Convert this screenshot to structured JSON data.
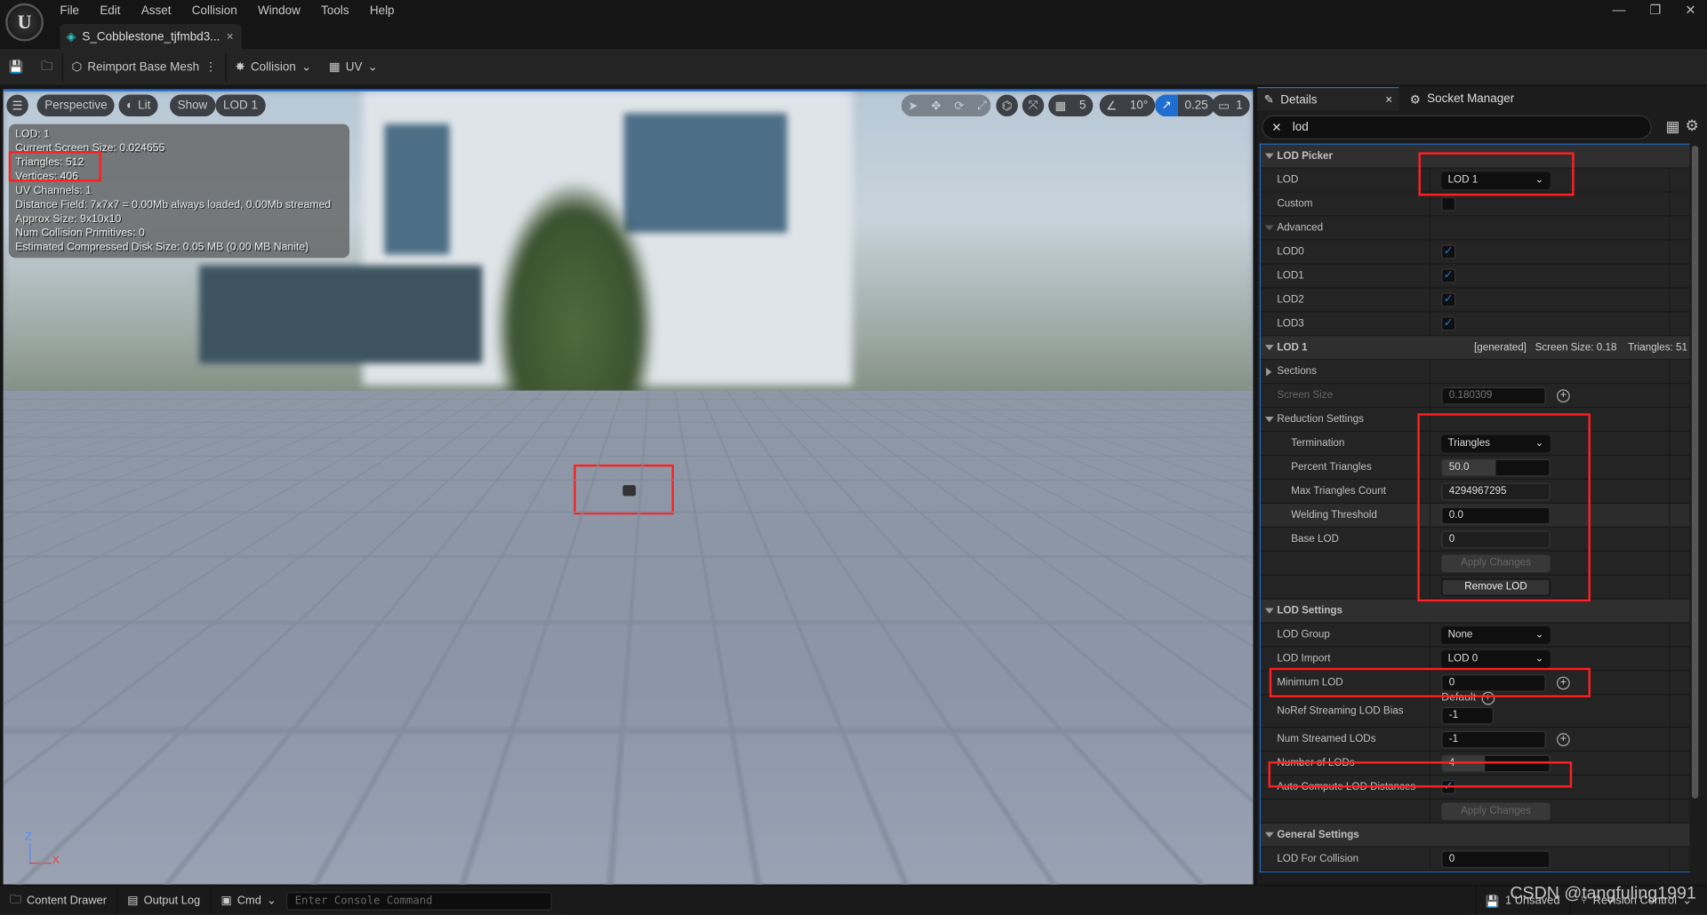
{
  "app": {
    "menu": [
      "File",
      "Edit",
      "Asset",
      "Collision",
      "Window",
      "Tools",
      "Help"
    ],
    "document_tab": "S_Cobblestone_tjfmbd3...",
    "window_controls": [
      "—",
      "❐",
      "✕"
    ]
  },
  "toolbar": {
    "reimport": "Reimport Base Mesh",
    "collision": "Collision",
    "uv": "UV"
  },
  "viewport": {
    "buttons": {
      "perspective": "Perspective",
      "lit": "Lit",
      "show": "Show",
      "lod": "LOD 1"
    },
    "snap": {
      "grid": "5",
      "angle": "10°",
      "scale": "0.25",
      "camera": "1"
    },
    "stats": [
      "LOD: 1",
      "Current Screen Size: 0.024655",
      "Triangles: 512",
      "Vertices: 406",
      "UV Channels: 1",
      "Distance Field: 7x7x7 = 0.00Mb always loaded, 0.00Mb streamed",
      "Approx Size: 9x10x10",
      "Num Collision Primitives: 0",
      "Estimated Compressed Disk Size: 0.05 MB (0.00 MB Nanite)"
    ],
    "axis": {
      "z": "Z",
      "x": "X"
    },
    "highlight_color": "#ff2020"
  },
  "details": {
    "tab_details": "Details",
    "tab_socket": "Socket Manager",
    "search_value": "lod",
    "lod_picker": {
      "title": "LOD Picker",
      "lod_label": "LOD",
      "lod_value": "LOD 1",
      "custom_label": "Custom",
      "custom_checked": false,
      "advanced_label": "Advanced",
      "lods": [
        {
          "label": "LOD0",
          "checked": true
        },
        {
          "label": "LOD1",
          "checked": true
        },
        {
          "label": "LOD2",
          "checked": true
        },
        {
          "label": "LOD3",
          "checked": true
        }
      ]
    },
    "lod1": {
      "title": "LOD 1",
      "info": "[generated]   Screen Size: 0.18    Triangles: 51",
      "sections": "Sections",
      "screen_size_label": "Screen Size",
      "screen_size": "0.180309"
    },
    "reduction": {
      "title": "Reduction Settings",
      "termination_label": "Termination",
      "termination": "Triangles",
      "percent_label": "Percent Triangles",
      "percent": "50.0",
      "percent_fill": 50,
      "max_label": "Max Triangles Count",
      "max": "4294967295",
      "welding_label": "Welding Threshold",
      "welding": "0.0",
      "base_label": "Base LOD",
      "base": "0",
      "apply": "Apply Changes",
      "remove": "Remove LOD"
    },
    "lod_settings": {
      "title": "LOD Settings",
      "group_label": "LOD Group",
      "group": "None",
      "import_label": "LOD Import",
      "import": "LOD 0",
      "min_label": "Minimum LOD",
      "min": "0",
      "noref_label": "NoRef Streaming LOD Bias",
      "noref_default": "Default",
      "noref": "-1",
      "streamed_label": "Num Streamed LODs",
      "streamed": "-1",
      "num_label": "Number of LODs",
      "num": "4",
      "auto_label": "Auto Compute LOD Distances",
      "auto_checked": true,
      "apply": "Apply Changes"
    },
    "general": {
      "title": "General Settings",
      "collision_label": "LOD For Collision",
      "collision": "0"
    }
  },
  "bottom": {
    "content_drawer": "Content Drawer",
    "output_log": "Output Log",
    "cmd": "Cmd",
    "console_placeholder": "Enter Console Command",
    "unsaved": "1 Unsaved",
    "revision": "Revision Control"
  },
  "watermark": "CSDN @tangfuling1991"
}
